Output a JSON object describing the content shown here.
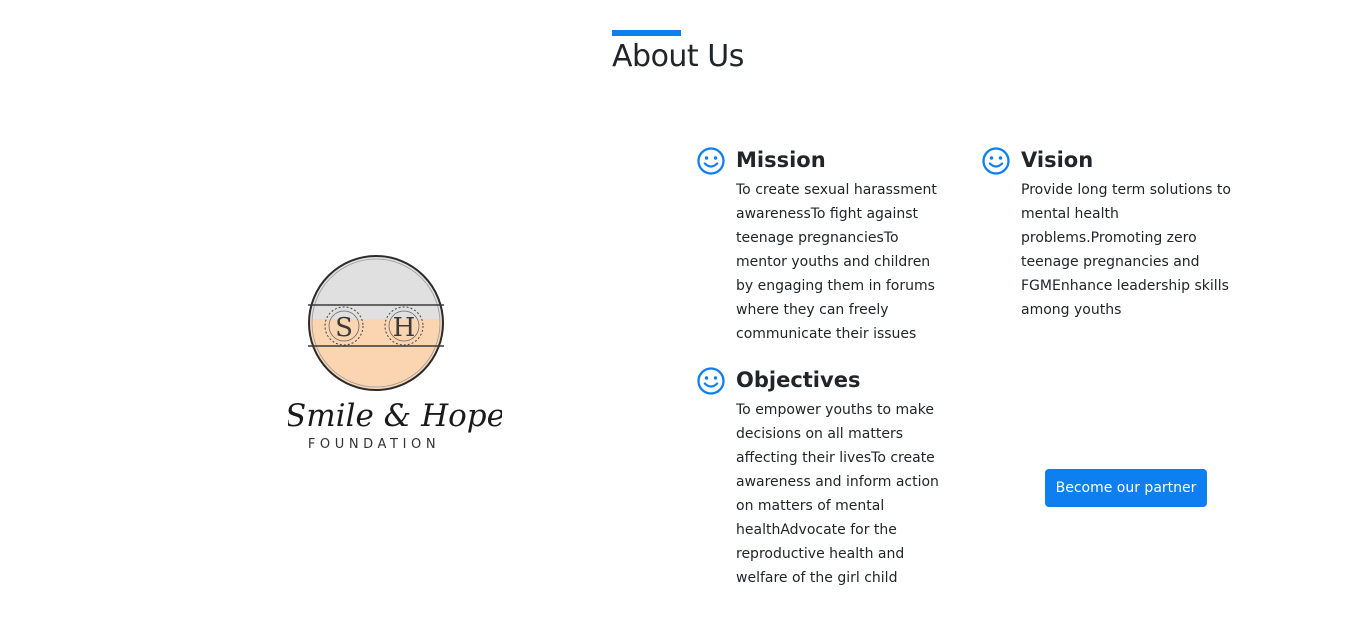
{
  "section": {
    "title": "About Us"
  },
  "logo": {
    "initials": [
      "S",
      "H"
    ],
    "script": "Smile & Hope",
    "subtitle": "FOUNDATION"
  },
  "mission": {
    "title": "Mission",
    "text": "To create sexual harassment awarenessTo fight against teenage pregnanciesTo mentor youths and children by engaging them in forums where they can freely communicate their issues"
  },
  "vision": {
    "title": "Vision",
    "text": "Provide long term solutions to mental health problems.Promoting zero teenage pregnancies and FGMEnhance leadership skills among youths"
  },
  "objectives": {
    "title": "Objectives",
    "text": "To empower youths to make decisions on all matters affecting their livesTo create awareness and inform action on matters of mental healthAdvocate for the reproductive health and welfare of the girl child"
  },
  "cta": {
    "label": "Become our partner"
  },
  "icons": {
    "feature": "smiley-icon"
  },
  "colors": {
    "accent": "#0d7ff0",
    "text": "#212529",
    "logo_peach": "#fbd5b2",
    "logo_grey": "#e0e0e0"
  }
}
